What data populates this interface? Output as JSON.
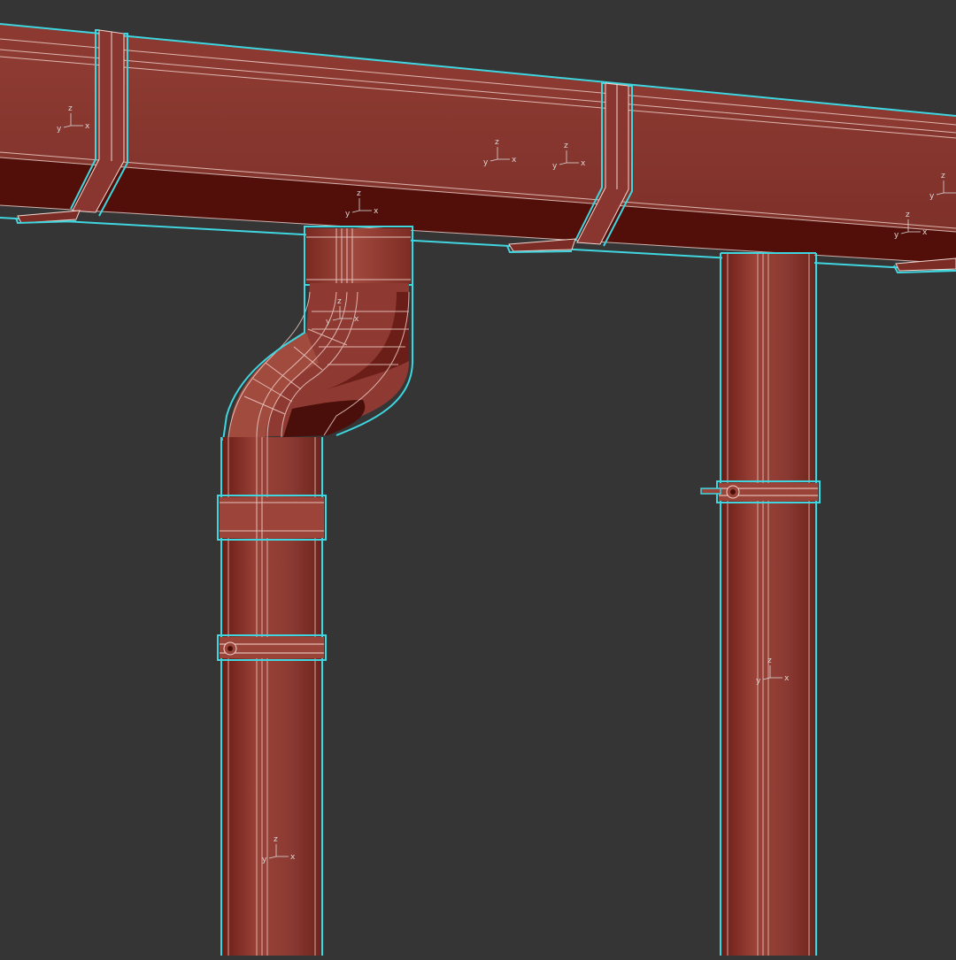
{
  "colors": {
    "background": "#353535",
    "pipe_main": "#8a3a32",
    "pipe_light": "#9b4238",
    "pipe_dark": "#5e1812",
    "pipe_deep": "#4a0f0b",
    "selection_outline": "#3fd6df",
    "wire": "#f2d6d0",
    "gizmo": "#d8d8d8"
  },
  "gizmo_labels": {
    "z": "z",
    "y": "y",
    "x": "x"
  },
  "objects": [
    "gutter",
    "gutter-joint-bracket",
    "gutter-hook",
    "downpipe-outlet",
    "downpipe-elbow",
    "downpipe-socket",
    "pipe-clamp",
    "downpipe"
  ]
}
